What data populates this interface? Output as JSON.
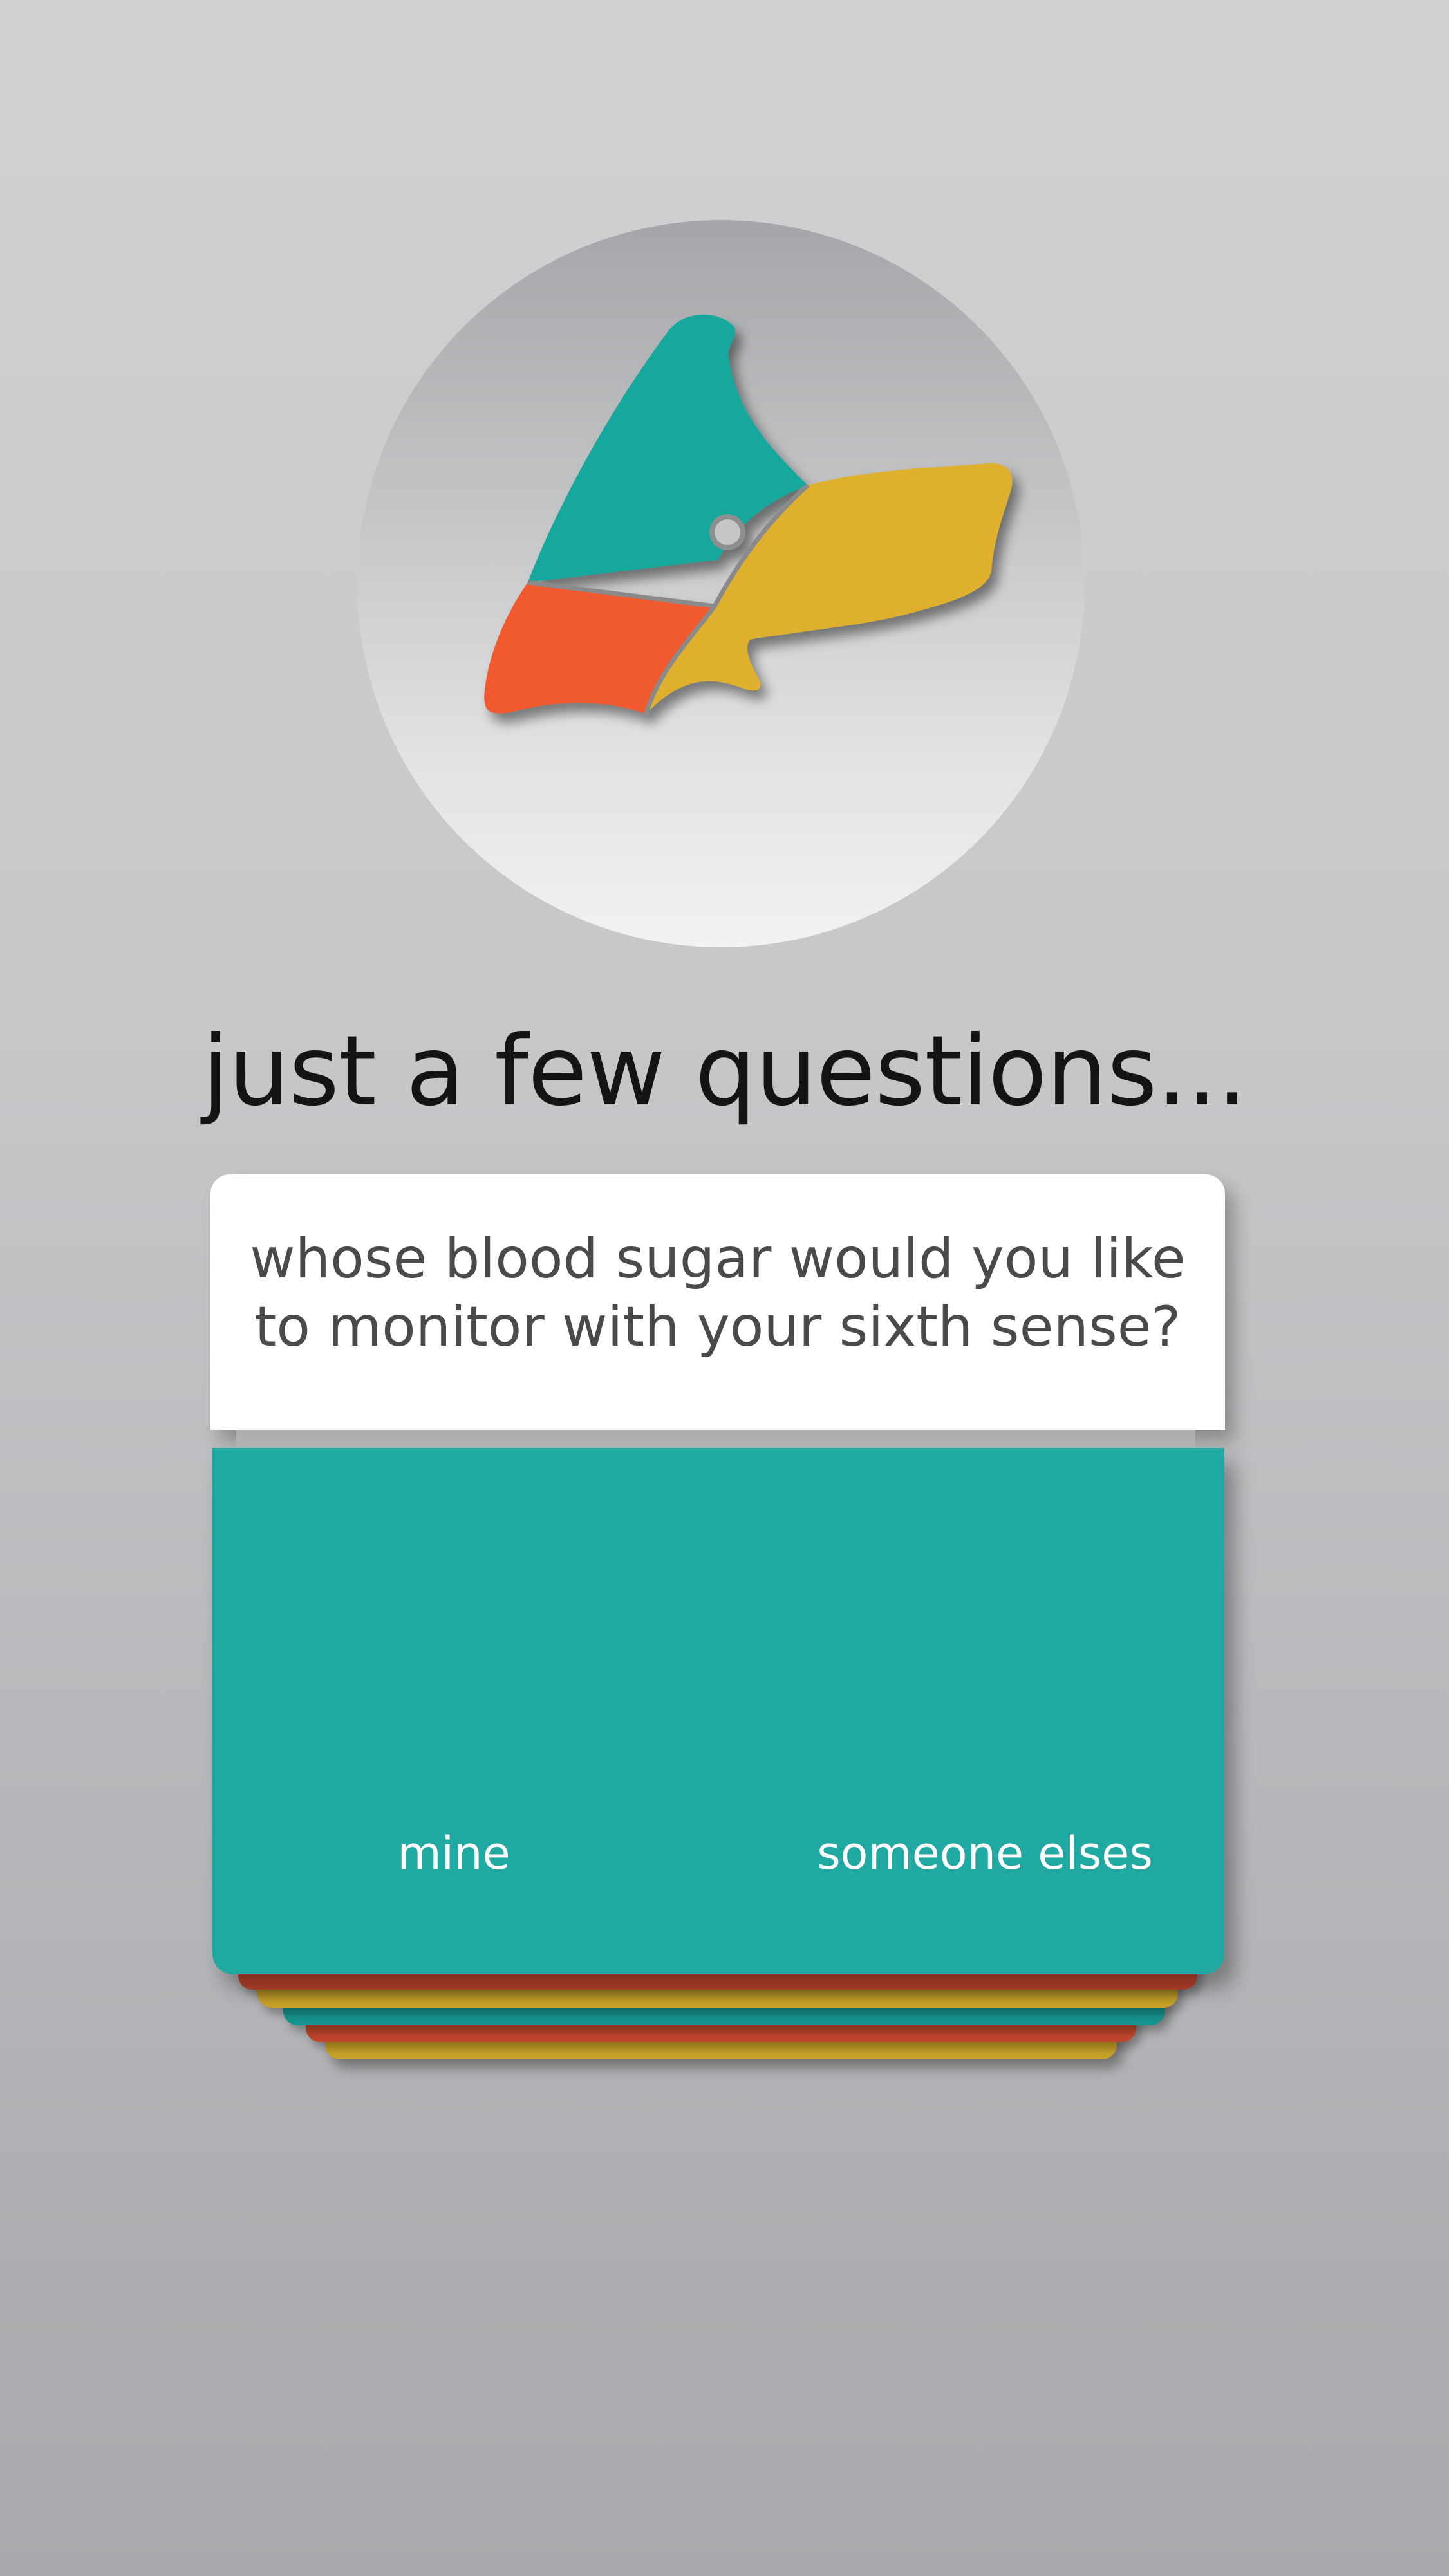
{
  "header": {
    "title": "just a few questions..."
  },
  "question_card": {
    "question": "whose blood sugar would you like\nto monitor with your sixth sense?"
  },
  "answers": {
    "option_1": "mine",
    "option_2": "someone elses"
  },
  "colors": {
    "teal": "#12a79d",
    "orange": "#f05a2d",
    "gold": "#deb02d",
    "card_teal": "#20a9a2",
    "stack_red": "#c0462c",
    "stack_gold": "#c9a22a",
    "stack_teal": "#16948e"
  },
  "logo": {
    "icon": "dog-head-logo-icon"
  }
}
